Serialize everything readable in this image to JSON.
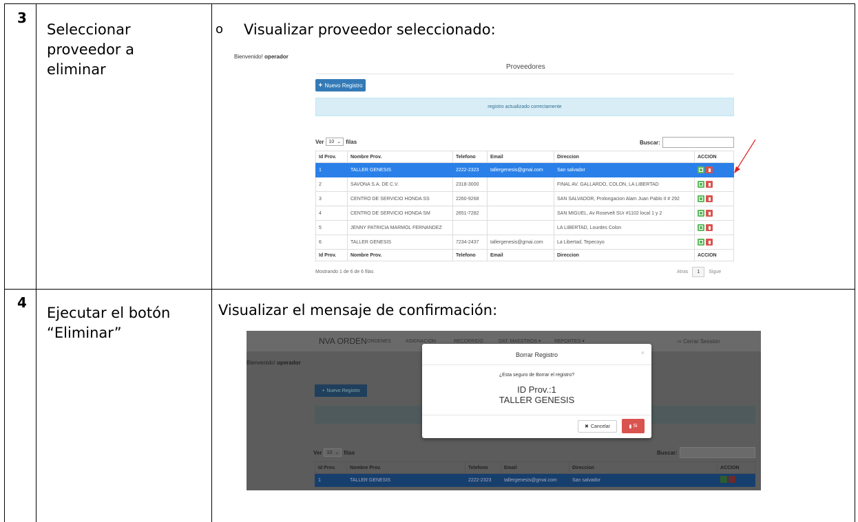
{
  "rows": [
    {
      "number": "3",
      "description": [
        "Seleccionar",
        "proveedor a",
        "eliminar"
      ],
      "bullet": "o",
      "heading": "Visualizar proveedor seleccionado:",
      "screenshot": {
        "welcome_prefix": "Bienvenido!",
        "welcome_user": "operador",
        "title": "Proveedores",
        "new_button": "Nuevo Registro",
        "alert": "registro actualizado correctamente",
        "length_label_prefix": "Ver",
        "length_value": "10",
        "length_label_suffix": "filas",
        "search_label": "Buscar:",
        "columns": [
          "Id Prov.",
          "Nombre Prov.",
          "Telefono",
          "Email",
          "Direccion",
          "ACCION"
        ],
        "rows": [
          [
            "1",
            "TALLER GENESIS",
            "2222-2323",
            "tallergenesis@gmai.com",
            "San salvador"
          ],
          [
            "2",
            "SAVONA S.A. DE C.V.",
            "2318-3000",
            "",
            "FINAL AV. GALLARDO, COLON, LA LIBERTAD"
          ],
          [
            "3",
            "CENTRO DE SERVICIO HONDA SS",
            "2260-9268",
            "",
            "SAN SALVADOR, Prolongacion Alam Juan Pablo II # 292"
          ],
          [
            "4",
            "CENTRO DE SERVICIO HONDA SM",
            "2651-7282",
            "",
            "SAN MIGUEL, Av Rosevelt SUr #1102 local 1 y 2"
          ],
          [
            "5",
            "JENNY PATRICIA MARMOL FERNANDEZ",
            "",
            "",
            "LA LIBERTAD, Lourdes Colon"
          ],
          [
            "6",
            "TALLER GENESIS",
            "7234-2437",
            "tallergenesis@gmai.com",
            "La Libertad, Tepecoyo"
          ]
        ],
        "selected_row": 0,
        "info": "Mostrando 1 de 6 de 6 filas",
        "prev": "Atras",
        "page": "1",
        "next": "Sigue"
      }
    },
    {
      "number": "4",
      "description": [
        "Ejecutar el botón",
        "“Eliminar”"
      ],
      "heading": "Visualizar el mensaje de confirmación:",
      "screenshot": {
        "brand": "NVA ORDEN",
        "nav": [
          "ORDENES",
          "ASIGNACION",
          "RECORRIDO",
          "DAT. MAESTROS ▾",
          "REPORTES ▾"
        ],
        "logout": "Cerrar Session",
        "welcome_prefix": "Bienvenido!",
        "welcome_user": "operador",
        "new_button": "Nuevo Registro",
        "length_label_prefix": "Ver",
        "length_value": "10",
        "length_label_suffix": "filas",
        "search_label": "Buscar:",
        "columns": [
          "Id Prov.",
          "Nombre Prov.",
          "Telefono",
          "Email",
          "Direccion",
          "ACCION"
        ],
        "row": [
          "1",
          "TALLER GENESIS",
          "2222-2323",
          "tallergenesis@gmai.com",
          "San salvador"
        ],
        "modal": {
          "title": "Borrar Registro",
          "close": "×",
          "question": "¿Esta seguro de Borrar el registro?",
          "id_line": "ID Prov.:1",
          "name_line": "TALLER GENESIS",
          "cancel": "Cancelar",
          "confirm": "Si"
        }
      }
    }
  ],
  "colors": {
    "selected_row": "#2a80e8",
    "primary": "#337ab7",
    "danger": "#d9534f",
    "success": "#5cb85c",
    "alert_bg": "#d9edf7"
  }
}
